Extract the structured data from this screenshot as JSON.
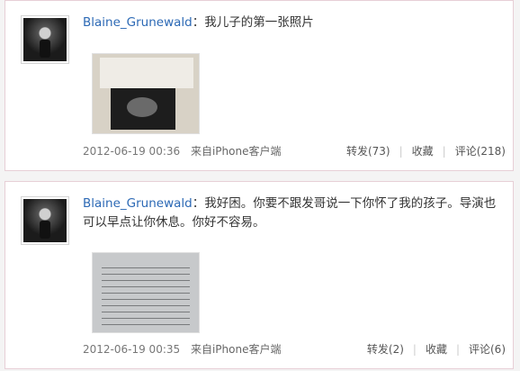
{
  "posts": [
    {
      "username": "Blaine_Grunewald",
      "colon": "：",
      "content": "我儿子的第一张照片",
      "timestamp": "2012-06-19 00:36",
      "source": "来自iPhone客户端",
      "repost": "转发(73)",
      "favorite": "收藏",
      "comment": "评论(218)"
    },
    {
      "username": "Blaine_Grunewald",
      "colon": "：",
      "content": "我好困。你要不跟发哥说一下你怀了我的孩子。导演也可以早点让你休息。你好不容易。",
      "timestamp": "2012-06-19 00:35",
      "source": "来自iPhone客户端",
      "repost": "转发(2)",
      "favorite": "收藏",
      "comment": "评论(6)"
    }
  ],
  "separator": "|",
  "icons": {
    "avatar": "user-photo-avatar",
    "image1": "ultrasound-photo",
    "image2": "document-photo"
  },
  "colors": {
    "username_link": "#2c69b5",
    "card_border": "#e7cfd6"
  }
}
